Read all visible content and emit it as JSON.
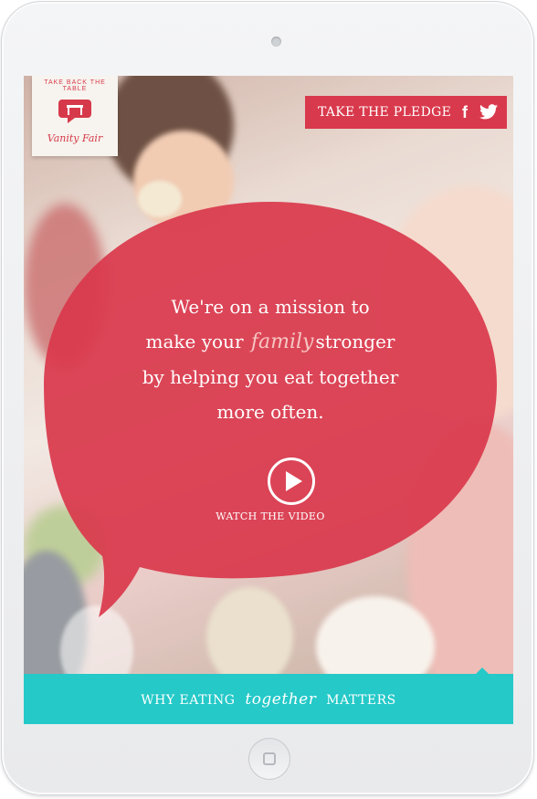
{
  "logo": {
    "arc_text": "TAKE BACK THE TABLE",
    "brand": "Vanity Fair",
    "color": "#d63a4a"
  },
  "header": {
    "pledge_label": "TAKE THE PLEDGE",
    "facebook_icon": "facebook-icon",
    "twitter_icon": "twitter-icon",
    "accent": "#d9394c"
  },
  "hero": {
    "line1": "We're on a mission to",
    "line2_before": "make your",
    "line2_script": "family",
    "line2_after": "stronger",
    "line3": "by helping you eat together",
    "line4": "more often.",
    "watch_label": "WATCH THE VIDEO",
    "play_icon": "play-circle-icon",
    "bubble_color": "#d9394c"
  },
  "footer": {
    "before": "WHY EATING",
    "script": "together",
    "after": "MATTERS",
    "color": "#24c9c8"
  }
}
